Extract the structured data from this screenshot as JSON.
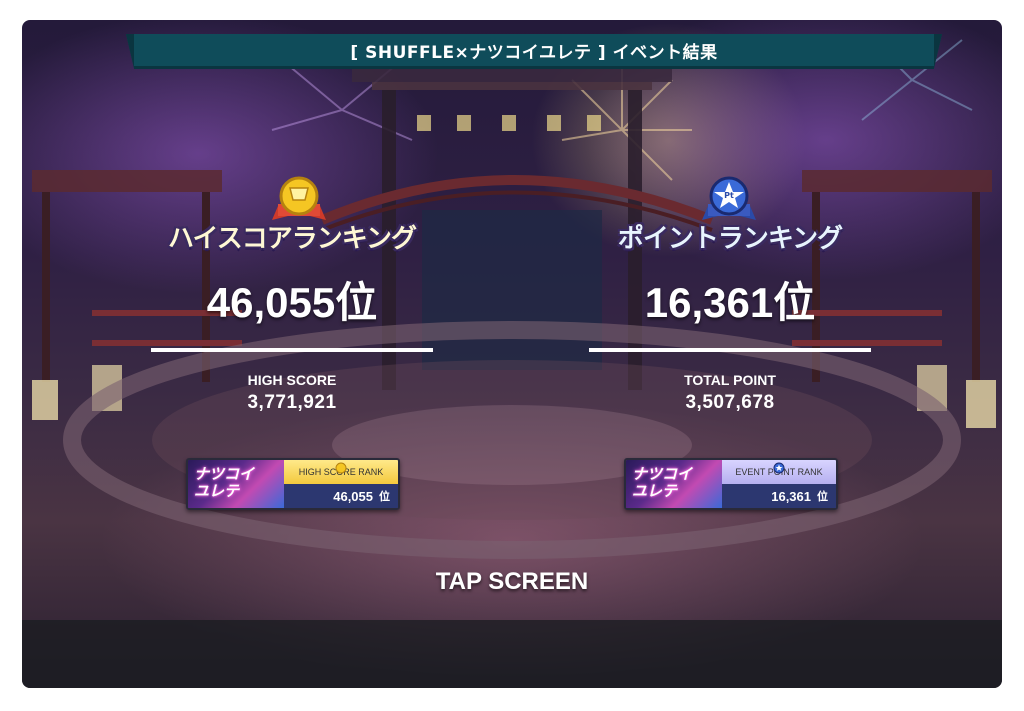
{
  "header": {
    "title": "[ SHUFFLE×ナツコイユレテ ] イベント結果"
  },
  "left": {
    "label": "ハイスコアランキング",
    "rank_value": "46,055位",
    "score_label": "HIGH SCORE",
    "score_value": "3,771,921",
    "medal_icon": "gold-medal-icon",
    "card": {
      "thumb_text": "ナツコイ\nユレテ",
      "label": "HIGH SCORE RANK",
      "rank": "46,055",
      "unit": "位"
    }
  },
  "right": {
    "label": "ポイントランキング",
    "rank_value": "16,361位",
    "score_label": "TOTAL POINT",
    "score_value": "3,507,678",
    "medal_icon": "pt-star-medal-icon",
    "card": {
      "thumb_text": "ナツコイ\nユレテ",
      "label": "EVENT POINT RANK",
      "rank": "16,361",
      "unit": "位"
    }
  },
  "footer": {
    "tap_label": "TAP SCREEN"
  },
  "colors": {
    "title_bar": "#0f4c5a",
    "gold": "#f3c93e",
    "blue_medal": "#2f57b8",
    "card_bottom": "#2c3770"
  }
}
